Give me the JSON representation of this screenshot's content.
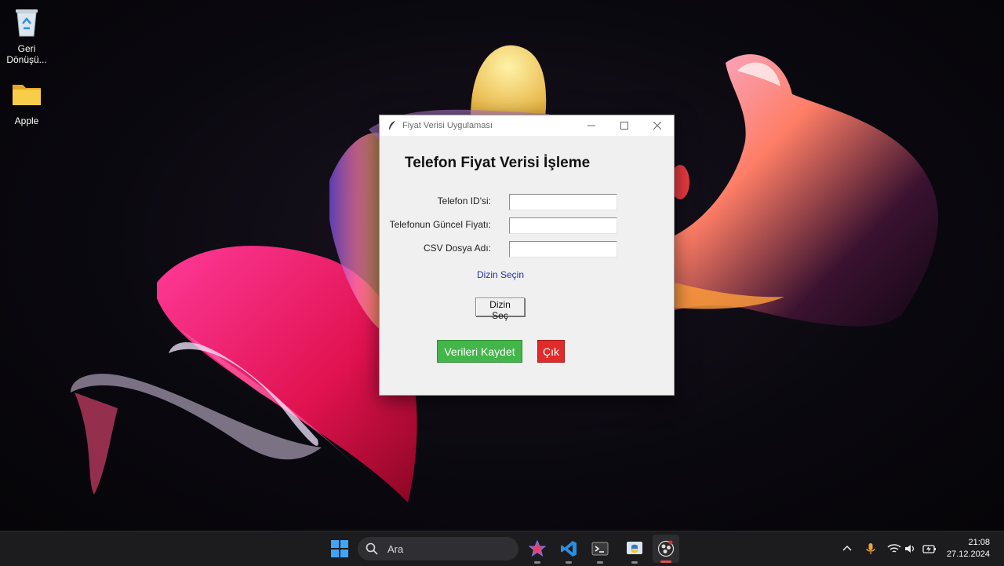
{
  "desktop": {
    "icons": [
      {
        "label": "Geri\nDönüşü..."
      },
      {
        "label": "Apple"
      }
    ]
  },
  "window": {
    "title": "Fiyat Verisi Uygulaması",
    "heading": "Telefon Fiyat Verisi İşleme",
    "fields": [
      {
        "label": "Telefon ID'si:",
        "value": ""
      },
      {
        "label": "Telefonun Güncel Fiyatı:",
        "value": ""
      },
      {
        "label": "CSV Dosya Adı:",
        "value": ""
      }
    ],
    "directory_label": "Dizin Seçin",
    "select_dir_button": "Dizin Seç",
    "save_button": "Verileri Kaydet",
    "exit_button": "Çık",
    "colors": {
      "save": "#43b649",
      "exit": "#e02b2b",
      "directory_label": "#1e2fb5"
    }
  },
  "taskbar": {
    "search_placeholder": "Ara",
    "apps": [
      "windows-start",
      "search",
      "app-browser",
      "vscode",
      "terminal",
      "python-idle",
      "obs-recorder"
    ],
    "clock": {
      "time": "21:08",
      "date": "27.12.2024"
    }
  }
}
